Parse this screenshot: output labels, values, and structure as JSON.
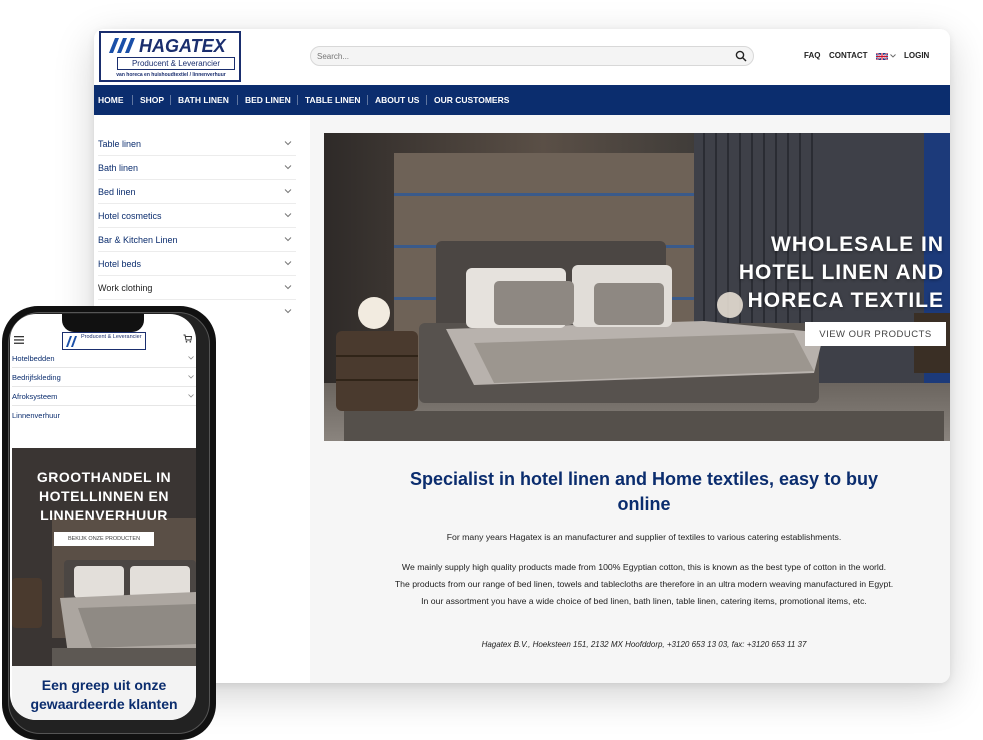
{
  "brand": {
    "name": "HAGATEX",
    "tagline": "Producent & Leverancier",
    "subline": "van horeca en huishoudtextiel / linnenverhuur",
    "color": "#0b2d6e"
  },
  "search": {
    "placeholder": "Search..."
  },
  "toplinks": {
    "faq": "FAQ",
    "contact": "CONTACT",
    "login": "LOGIN",
    "language_flag": "uk-flag-icon"
  },
  "nav": {
    "items": [
      "HOME",
      "SHOP",
      "BATH LINEN",
      "BED LINEN",
      "TABLE LINEN",
      "ABOUT US",
      "OUR CUSTOMERS"
    ]
  },
  "sidebar": {
    "items": [
      "Table linen",
      "Bath linen",
      "Bed linen",
      "Hotel cosmetics",
      "Bar & Kitchen Linen",
      "Hotel beds",
      "Work clothing"
    ]
  },
  "hero": {
    "title_line1": "WHOLESALE IN",
    "title_line2": "HOTEL LINEN AND",
    "title_line3": "HORECA TEXTILE",
    "button": "VIEW OUR PRODUCTS"
  },
  "content": {
    "title": "Specialist in hotel linen and Home textiles, easy to buy online",
    "p1": "For many years Hagatex is an manufacturer and supplier of textiles to various catering establishments.",
    "p2": "We mainly supply high quality products made from 100% Egyptian cotton, this is known as the best type of cotton in the world. The products from our range of bed linen, towels and tablecloths are therefore in an ultra modern weaving manufactured in Egypt. In our assortment you have a wide choice of bed linen, bath linen, table linen, catering items, promotional items, etc.",
    "address": "Hagatex B.V., Hoeksteen 151, 2132 MX Hoofddorp, +3120 653 13 03, fax: +3120 653 11 37"
  },
  "mobile": {
    "logo_tagline": "Producent & Leverancier",
    "menu_items": [
      "Hotelbedden",
      "Bedrijfskleding",
      "Afroksysteem",
      "Linnenverhuur"
    ],
    "hero_line1": "GROOTHANDEL IN",
    "hero_line2": "HOTELLINNEN EN",
    "hero_line3": "LINNENVERHUUR",
    "hero_button": "BEKIJK ONZE PRODUCTEN",
    "section_title": "Een greep uit onze gewaardeerde klanten"
  }
}
